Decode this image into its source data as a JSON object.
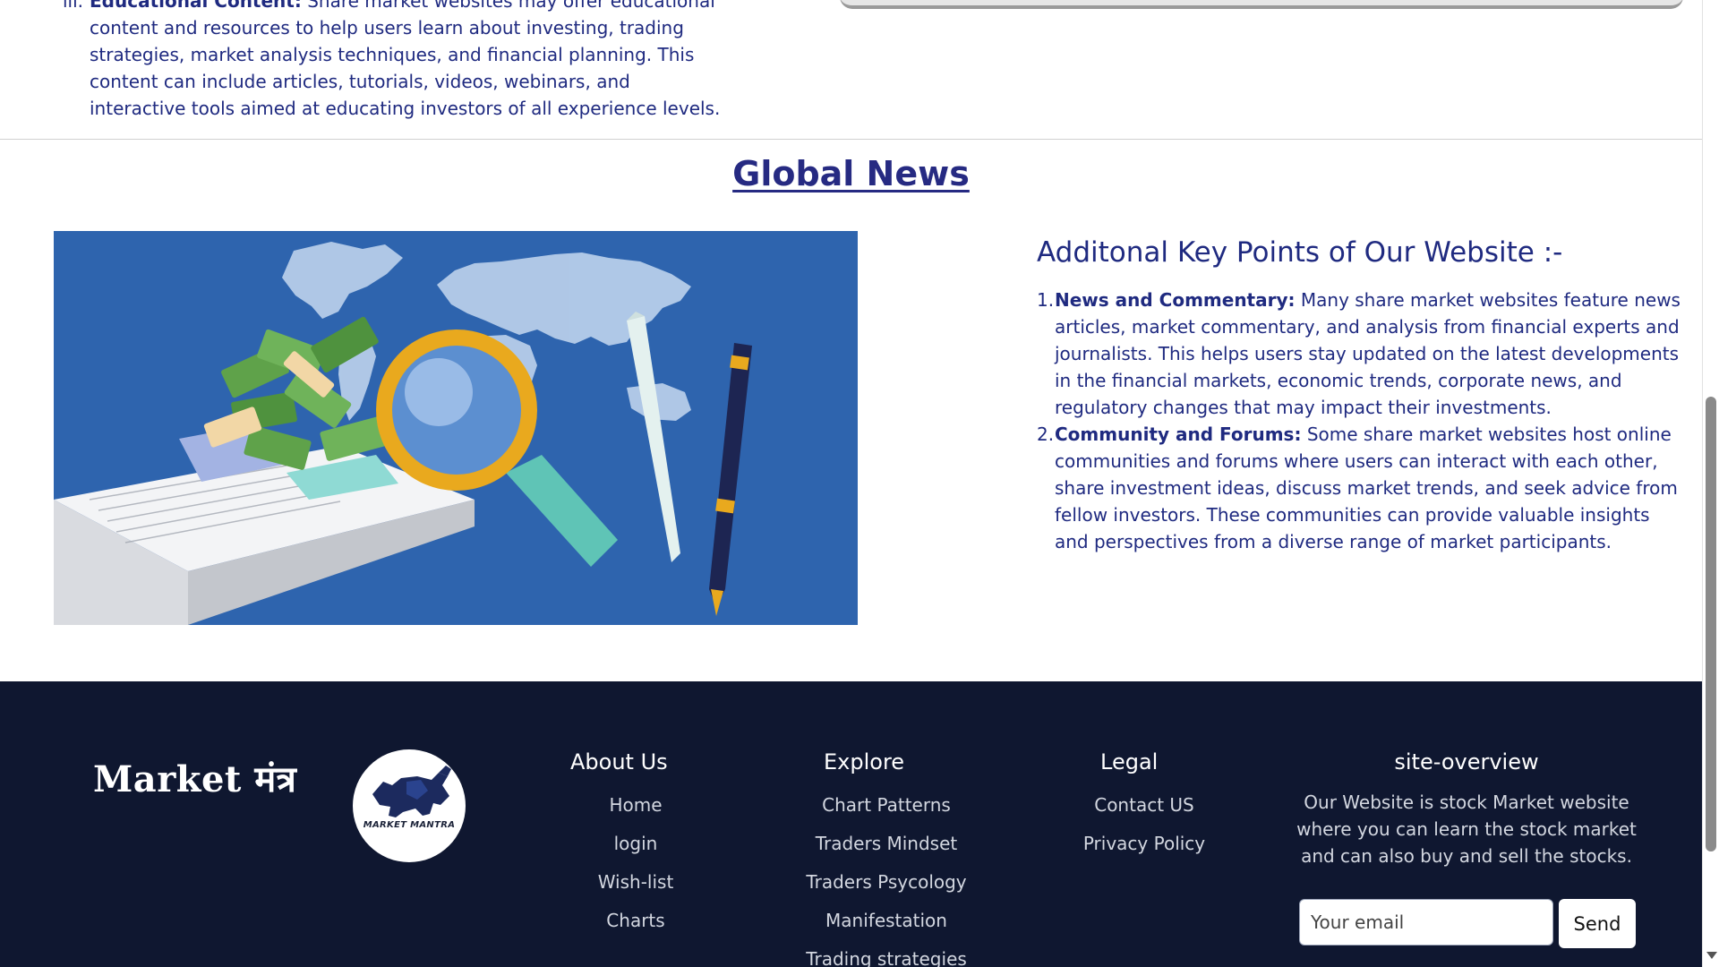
{
  "top_section": {
    "item_marker": "iii.",
    "item_title": "Educational Content:",
    "item_text": "Share market websites may offer educational content and resources to help users learn about investing, trading strategies, market analysis techniques, and financial planning. This content can include articles, tutorials, videos, webinars, and interactive tools aimed at educating investors of all experience levels."
  },
  "global_news": {
    "title": "Global News",
    "key_points_heading": "Additonal Key Points of Our Website :-",
    "points": [
      {
        "num": "1.",
        "title": "News and Commentary:",
        "text": "Many share market websites feature news articles, market commentary, and analysis from financial experts and journalists. This helps users stay updated on the latest developments in the financial markets, economic trends, corporate news, and regulatory changes that may impact their investments."
      },
      {
        "num": "2.",
        "title": "Community and Forums:",
        "text": "Some share market websites host online communities and forums where users can interact with each other, share investment ideas, discuss market trends, and seek advice from fellow investors. These communities can provide valuable insights and perspectives from a diverse range of market participants."
      }
    ]
  },
  "footer": {
    "brand": "Market मंत्र",
    "logo_text": "MARKET MANTRA",
    "about": {
      "heading": "About Us",
      "links": [
        "Home",
        "login",
        "Wish-list",
        "Charts"
      ]
    },
    "explore": {
      "heading": "Explore",
      "links": [
        "Chart Patterns",
        "Traders Mindset",
        "Traders Psycology",
        "Manifestation",
        "Trading strategies"
      ]
    },
    "legal": {
      "heading": "Legal",
      "links": [
        "Contact US",
        "Privacy Policy"
      ]
    },
    "overview": {
      "heading": "site-overview",
      "text": "Our Website is stock Market website where you can learn the stock market and can also buy and sell the stocks.",
      "email_placeholder": "Your email",
      "send_label": "Send"
    }
  },
  "colors": {
    "text_blue": "#1f2a80",
    "image_bg": "#2e64ae",
    "footer_bg": "#0f1730"
  }
}
